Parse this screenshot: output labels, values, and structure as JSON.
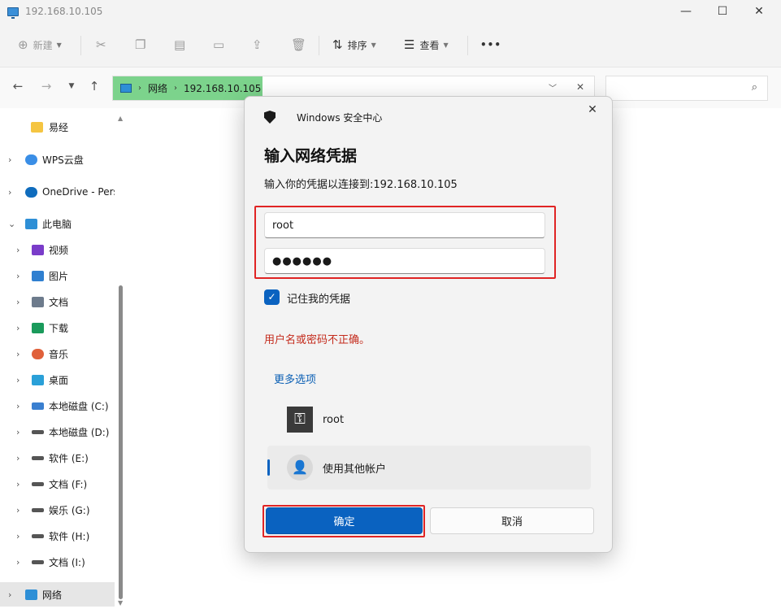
{
  "window": {
    "title": "192.168.10.105",
    "minimize": "—",
    "maximize": "☐",
    "close": "✕"
  },
  "toolbar": {
    "new_label": "新建",
    "sort_label": "排序",
    "view_label": "查看",
    "more_label": "•••"
  },
  "address": {
    "segments": [
      "网络",
      "192.168.10.105"
    ],
    "search_placeholder": ""
  },
  "sidebar": {
    "items": [
      {
        "label": "易经",
        "icon": "folder-icon",
        "color": "#f5c542"
      },
      {
        "label": "WPS云盘",
        "icon": "cloud-icon",
        "color": "#3a8ee6"
      },
      {
        "label": "OneDrive - Personal",
        "icon": "onedrive-icon",
        "color": "#0f6cbd"
      },
      {
        "label": "此电脑",
        "icon": "pc-icon",
        "color": "#2e8fd6"
      },
      {
        "label": "视频",
        "icon": "video-icon",
        "color": "#7a3cc9"
      },
      {
        "label": "图片",
        "icon": "picture-icon",
        "color": "#2f7fd0"
      },
      {
        "label": "文档",
        "icon": "document-icon",
        "color": "#6d7b8c"
      },
      {
        "label": "下载",
        "icon": "download-icon",
        "color": "#1a9a5b"
      },
      {
        "label": "音乐",
        "icon": "music-icon",
        "color": "#e0603a"
      },
      {
        "label": "桌面",
        "icon": "desktop-icon",
        "color": "#2aa0d8"
      },
      {
        "label": "本地磁盘 (C:)",
        "icon": "windows-drive-icon",
        "color": "#3a7fd0"
      },
      {
        "label": "本地磁盘 (D:)",
        "icon": "drive-icon",
        "color": "#555555"
      },
      {
        "label": "软件 (E:)",
        "icon": "drive-icon",
        "color": "#555555"
      },
      {
        "label": "文档 (F:)",
        "icon": "drive-icon",
        "color": "#555555"
      },
      {
        "label": "娱乐 (G:)",
        "icon": "drive-icon",
        "color": "#555555"
      },
      {
        "label": "软件 (H:)",
        "icon": "drive-icon",
        "color": "#555555"
      },
      {
        "label": "文档 (I:)",
        "icon": "drive-icon",
        "color": "#555555"
      },
      {
        "label": "网络",
        "icon": "network-icon",
        "color": "#2e8fd6"
      }
    ]
  },
  "dialog": {
    "app_name": "Windows 安全中心",
    "title": "输入网络凭据",
    "subtitle": "输入你的凭据以连接到:192.168.10.105",
    "username_value": "root",
    "password_value": "●●●●●●",
    "remember_label": "记住我的凭据",
    "error_text": "用户名或密码不正确。",
    "more_options": "更多选项",
    "accounts": [
      "root",
      "使用其他帐户"
    ],
    "ok_label": "确定",
    "cancel_label": "取消",
    "accent_color": "#0a62c0",
    "error_color": "#c42b1c"
  }
}
